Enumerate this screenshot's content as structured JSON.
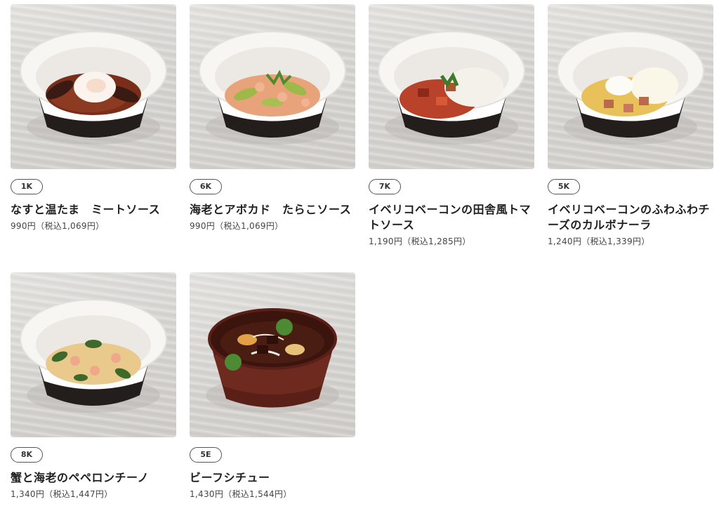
{
  "menu": {
    "items": [
      {
        "code": "1K",
        "name": "なすと温たま　ミートソース",
        "price": "990円（税込1,069円）",
        "bowl": "black",
        "sauce": "#7a2e1a",
        "topping": "egg"
      },
      {
        "code": "6K",
        "name": "海老とアボカド　たらこソース",
        "price": "990円（税込1,069円）",
        "bowl": "black",
        "sauce": "#e8a37a",
        "topping": "avocado"
      },
      {
        "code": "7K",
        "name": "イベリコベーコンの田舎風トマトソース",
        "price": "1,190円（税込1,285円）",
        "bowl": "black",
        "sauce": "#b8432a",
        "topping": "cheese"
      },
      {
        "code": "5K",
        "name": "イベリコベーコンのふわふわチーズのカルボナーラ",
        "price": "1,240円（税込1,339円）",
        "bowl": "black",
        "sauce": "#e8c15a",
        "topping": "cheese-egg"
      },
      {
        "code": "8K",
        "name": "蟹と海老のペペロンチーノ",
        "price": "1,340円（税込1,447円）",
        "bowl": "black",
        "sauce": "#e9c98c",
        "topping": "basil"
      },
      {
        "code": "5E",
        "name": "ビーフシチュー",
        "price": "1,430円（税込1,544円）",
        "bowl": "brown",
        "sauce": "#4a1d12",
        "topping": "stew"
      }
    ]
  }
}
